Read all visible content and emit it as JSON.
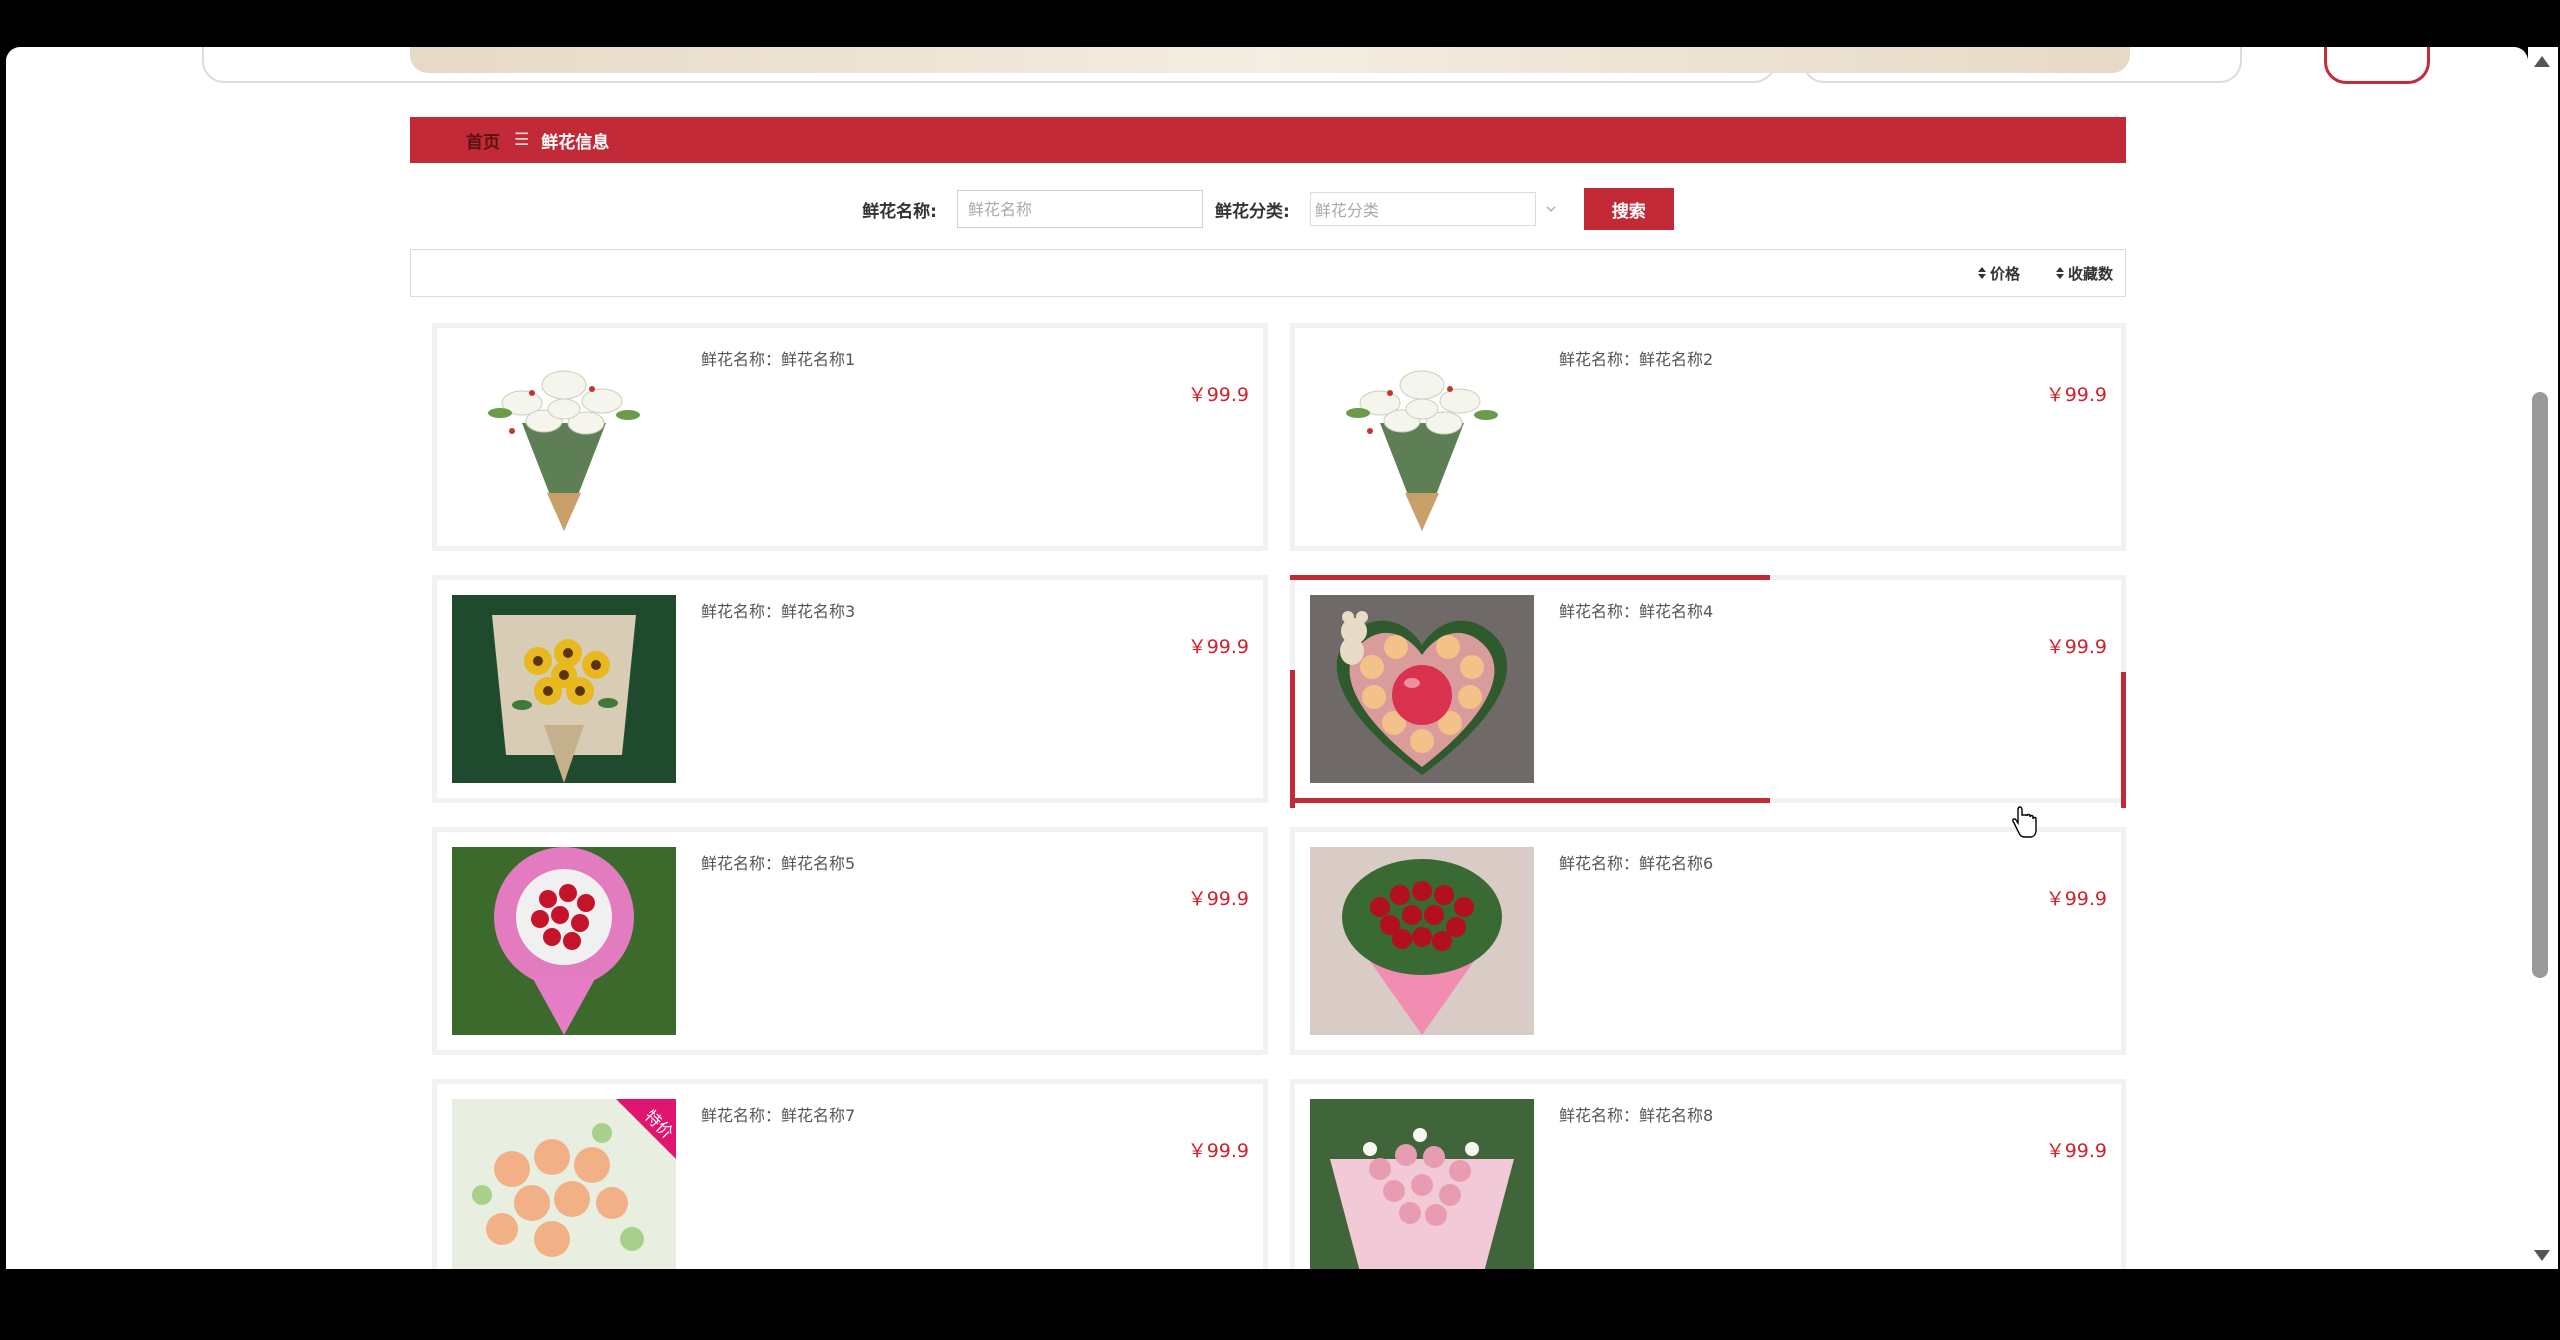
{
  "breadcrumb": {
    "home": "首页",
    "separator": "☰",
    "current": "鲜花信息"
  },
  "search": {
    "name_label": "鲜花名称:",
    "name_placeholder": "鲜花名称",
    "category_label": "鲜花分类:",
    "category_placeholder": "鲜花分类",
    "button_label": "搜索"
  },
  "sort": {
    "price_label": "价格",
    "favorites_label": "收藏数",
    "icon": "sort-icon"
  },
  "products": [
    {
      "name": "鲜花名称：鲜花名称1",
      "price": "￥99.9",
      "image": "lily-bouquet"
    },
    {
      "name": "鲜花名称：鲜花名称2",
      "price": "￥99.9",
      "image": "lily-bouquet"
    },
    {
      "name": "鲜花名称：鲜花名称3",
      "price": "￥99.9",
      "image": "sunflower-bouquet"
    },
    {
      "name": "鲜花名称：鲜花名称4",
      "price": "￥99.9",
      "image": "heart-roses-apple"
    },
    {
      "name": "鲜花名称：鲜花名称5",
      "price": "￥99.9",
      "image": "red-roses-pink-wrap"
    },
    {
      "name": "鲜花名称：鲜花名称6",
      "price": "￥99.9",
      "image": "red-roses-bouquet"
    },
    {
      "name": "鲜花名称：鲜花名称7",
      "price": "￥99.9",
      "image": "peach-roses-bouquet",
      "badge": "特价"
    },
    {
      "name": "鲜花名称：鲜花名称8",
      "price": "￥99.9",
      "image": "pink-mixed-bouquet"
    }
  ],
  "colors": {
    "accent": "#c32a37",
    "price": "#d4202a"
  }
}
